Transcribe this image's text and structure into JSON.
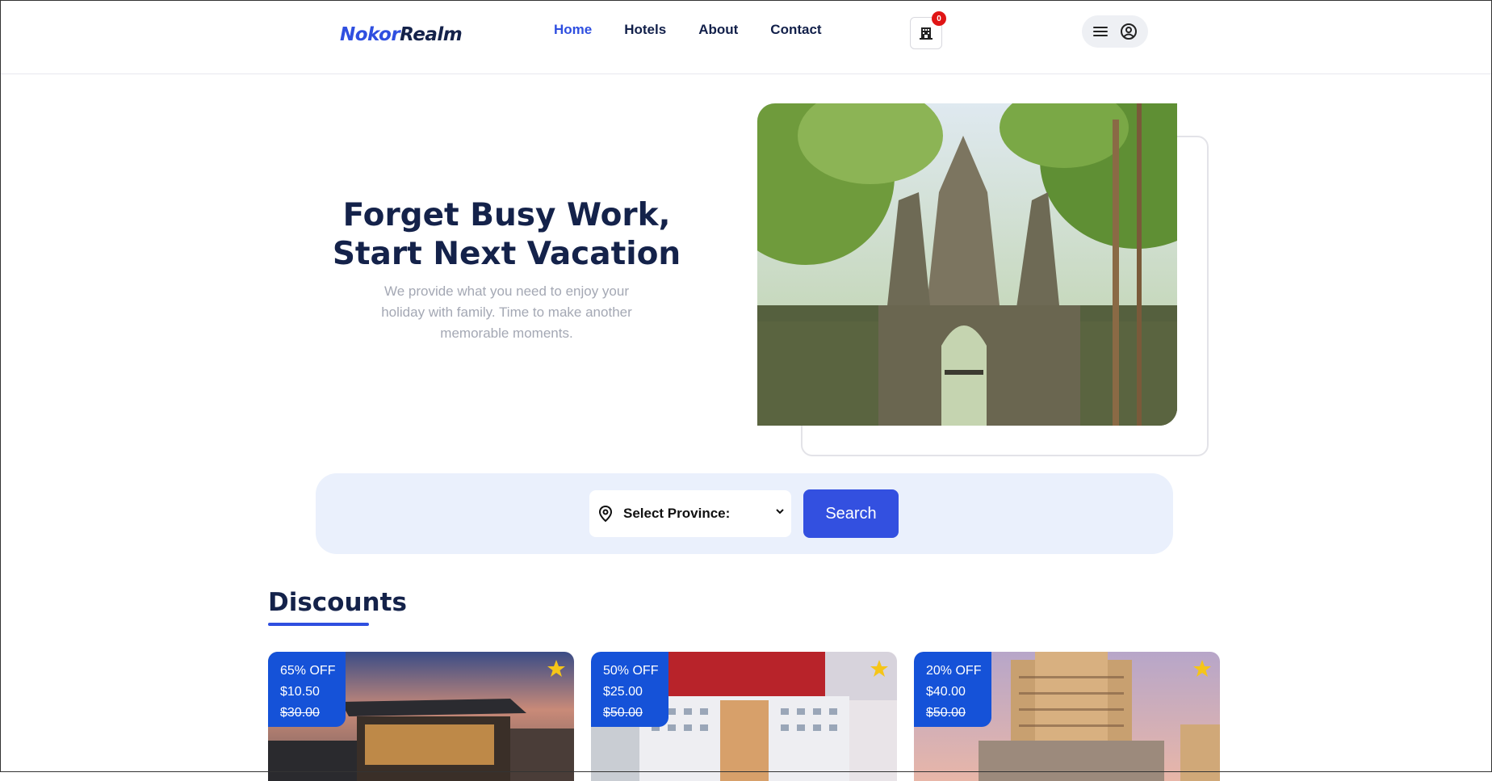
{
  "brand": {
    "part1": "Nokor",
    "part2": "Realm"
  },
  "nav": {
    "home": "Home",
    "hotels": "Hotels",
    "about": "About",
    "contact": "Contact"
  },
  "cart": {
    "count": "0",
    "icon": "hotel-icon"
  },
  "account": {
    "menu_icon": "menu-icon",
    "user_icon": "user-circle-icon"
  },
  "hero": {
    "title_line1": "Forget Busy Work,",
    "title_line2": "Start Next Vacation",
    "subtitle": "We provide what you need to enjoy your holiday with family. Time to make another memorable moments."
  },
  "search": {
    "select_label": "Select Province:",
    "button_label": "Search"
  },
  "discounts": {
    "title": "Discounts",
    "cards": [
      {
        "off": "65% OFF",
        "price": "$10.50",
        "old_price": "$30.00"
      },
      {
        "off": "50% OFF",
        "price": "$25.00",
        "old_price": "$50.00"
      },
      {
        "off": "20% OFF",
        "price": "$40.00",
        "old_price": "$50.00"
      }
    ]
  },
  "colors": {
    "accent": "#2f4fe0",
    "navy": "#14224a",
    "badge": "#1552d8",
    "star": "#f5c518",
    "search_band": "#eaf0fc"
  }
}
